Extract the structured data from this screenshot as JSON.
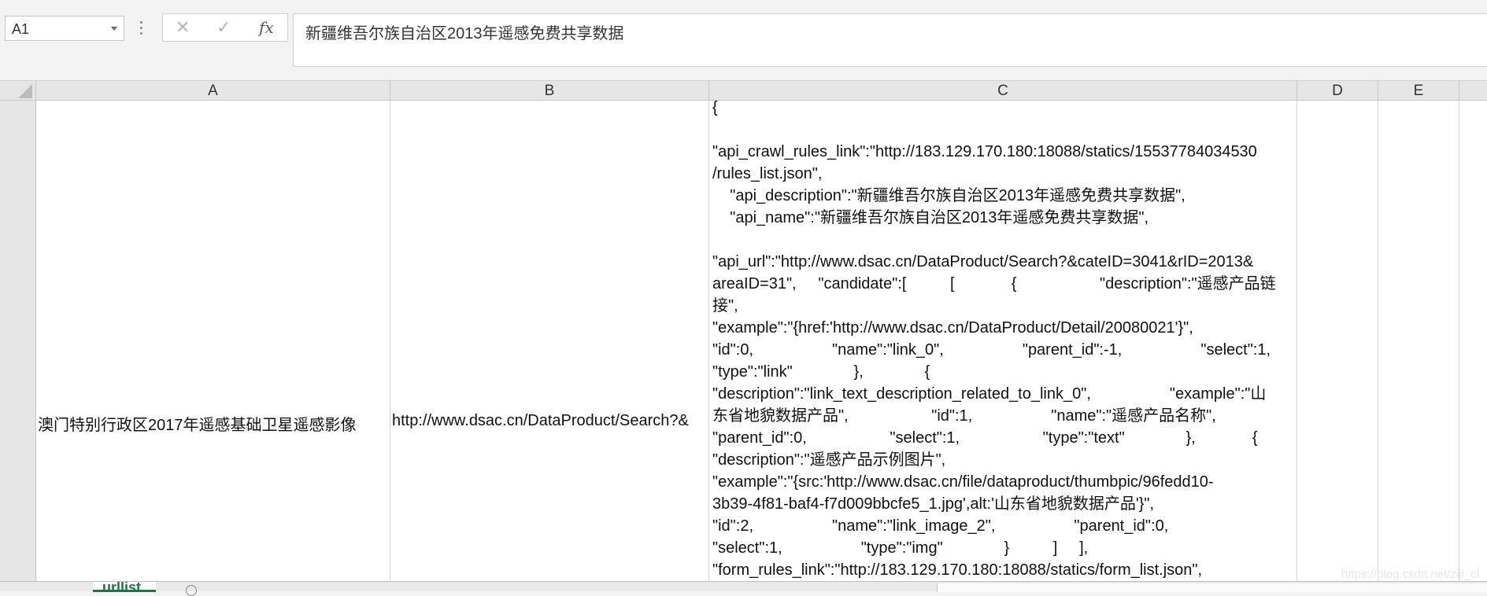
{
  "formula_bar": {
    "name_box": "A1",
    "cancel_icon": "✕",
    "enter_icon": "✓",
    "function_icon": "fx",
    "formula": "新疆维吾尔族自治区2013年遥感免费共享数据"
  },
  "columns": [
    "A",
    "B",
    "C",
    "D",
    "E"
  ],
  "row": {
    "A": "澳门特别行政区2017年遥感基础卫星遥感影像",
    "B": "http://www.dsac.cn/DataProduct/Search?&",
    "C": "{\n\n\"api_crawl_rules_link\":\"http://183.129.170.180:18088/statics/15537784034530\n/rules_list.json\",\n    \"api_description\":\"新疆维吾尔族自治区2013年遥感免费共享数据\",\n    \"api_name\":\"新疆维吾尔族自治区2013年遥感免费共享数据\",\n\n\"api_url\":\"http://www.dsac.cn/DataProduct/Search?&cateID=3041&rID=2013&\nareaID=31\",     \"candidate\":[          [             {                   \"description\":\"遥感产品链\n接\",\n\"example\":\"{href:'http://www.dsac.cn/DataProduct/Detail/20080021'}\",\n\"id\":0,                  \"name\":\"link_0\",                  \"parent_id\":-1,                  \"select\":1,\n\"type\":\"link\"              },              {\n\"description\":\"link_text_description_related_to_link_0\",                  \"example\":\"山\n东省地貌数据产品\",                   \"id\":1,                  \"name\":\"遥感产品名称\",\n\"parent_id\":0,                   \"select\":1,                   \"type\":\"text\"              },             {\n\"description\":\"遥感产品示例图片\",\n\"example\":\"{src:'http://www.dsac.cn/file/dataproduct/thumbpic/96fedd10-\n3b39-4f81-baf4-f7d009bbcfe5_1.jpg',alt:'山东省地貌数据产品'}\",\n\"id\":2,                  \"name\":\"link_image_2\",                  \"parent_id\":0,\n\"select\":1,                  \"type\":\"img\"              }          ]     ],\n\"form_rules_link\":\"http://183.129.170.180:18088/statics/form_list.json\","
  },
  "sheet_tab": "urllist",
  "watermark": "https://blog.csdn.net/ziji_cl"
}
